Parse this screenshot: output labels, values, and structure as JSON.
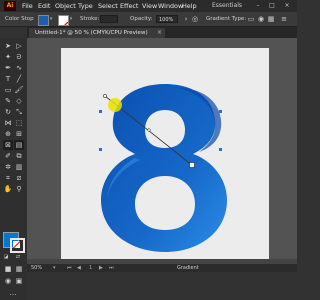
{
  "menubar": {
    "logo": "Ai",
    "items": [
      "File",
      "Edit",
      "Object",
      "Type",
      "Select",
      "Effect",
      "View",
      "Window",
      "Help"
    ],
    "workspace": "Essentials"
  },
  "controlbar": {
    "selection_label": "Color Stop",
    "fill_color": "#1a5fb4",
    "stroke_label": "Stroke:",
    "opacity_label": "Opacity:",
    "opacity_value": "100%",
    "gradient_label": "Gradient Type:"
  },
  "document_tab": {
    "title": "Untitled-1* @ 50 % (CMYK/CPU Preview)",
    "close_glyph": "×"
  },
  "toolbar": {
    "fill_color": "#0077d6",
    "stroke_color": "#ffffff"
  },
  "artwork": {
    "glyph": "8",
    "gradient_start": "#0a4fb0",
    "gradient_end": "#2a8ce8",
    "selection_color": "#e8e200"
  },
  "statusbar": {
    "zoom": "50%",
    "artboard_nav": "1",
    "active_tool": "Gradient"
  }
}
